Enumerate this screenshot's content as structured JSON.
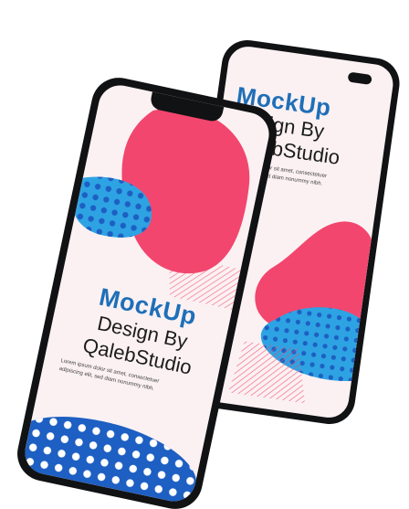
{
  "back_phone": {
    "title": "MockUp",
    "line2": "Design By",
    "line3": "QalebStudio",
    "body1": "Lorem ipsum dolor sit amet, consectetuer",
    "body2": "adipiscing elit, sed diam nonummy nibh."
  },
  "front_phone": {
    "title": "MockUp",
    "line2": "Design By",
    "line3": "QalebStudio",
    "body1": "Lorem ipsum dolor sit amet, consectetuer",
    "body2": "adipiscing elit, sed diam nonummy nibh."
  },
  "colors": {
    "title_blue": "#1f6fb8",
    "pink": "#f2466e",
    "light_blue": "#2ea3e3",
    "dark_blue": "#1d5fc2",
    "screen_bg": "#fbf1f2",
    "frame": "#111214"
  }
}
